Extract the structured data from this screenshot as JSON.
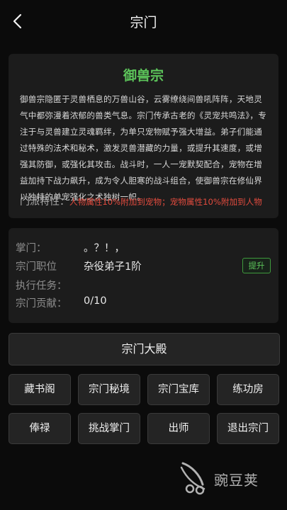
{
  "header": {
    "back_icon": "chevron-left-icon",
    "title": "宗门"
  },
  "intro": {
    "sect_name": "御兽宗",
    "description": "御兽宗隐匿于灵兽栖息的万兽山谷，云雾缭绕间兽吼阵阵，天地灵气中都弥漫着浓郁的兽类气息。宗门传承古老的《灵宠共鸣法》，专注于与灵兽建立灵魂羁绊，为单只宠物赋予强大增益。弟子们能通过特殊的法术和秘术，激发灵兽潜藏的力量，或提升其速度，或增强其防御，或强化其攻击。战斗时，一人一宠默契配合，宠物在增益加持下战力飙升，成为令人胆寒的战斗组合，使御兽宗在修仙界以独特的单宠强化之术独树一帜。",
    "trait_label": "门派特性：",
    "trait_value": "人物属性10%附加到宠物；宠物属性10%附加到人物"
  },
  "info": {
    "leader_label": "掌门：",
    "leader_value": "。？！，",
    "rank_label": "宗门职位",
    "rank_value": "杂役弟子1阶",
    "promote_label": "提升",
    "task_label": "执行任务：",
    "task_value": "",
    "contribution_label": "宗门贡献：",
    "contribution_value": "0/10"
  },
  "hall_button": "宗门大殿",
  "grid_buttons": [
    "藏书阁",
    "宗门秘境",
    "宗门宝库",
    "练功房",
    "俸禄",
    "挑战掌门",
    "出师",
    "退出宗门"
  ],
  "watermark": {
    "text": "豌豆荚",
    "icon": "wandoujia-logo-icon"
  },
  "colors": {
    "accent_green": "#5cc45a",
    "trait_red": "#e24b3e",
    "background": "#0b0b0b",
    "card": "#1c1c1c"
  }
}
